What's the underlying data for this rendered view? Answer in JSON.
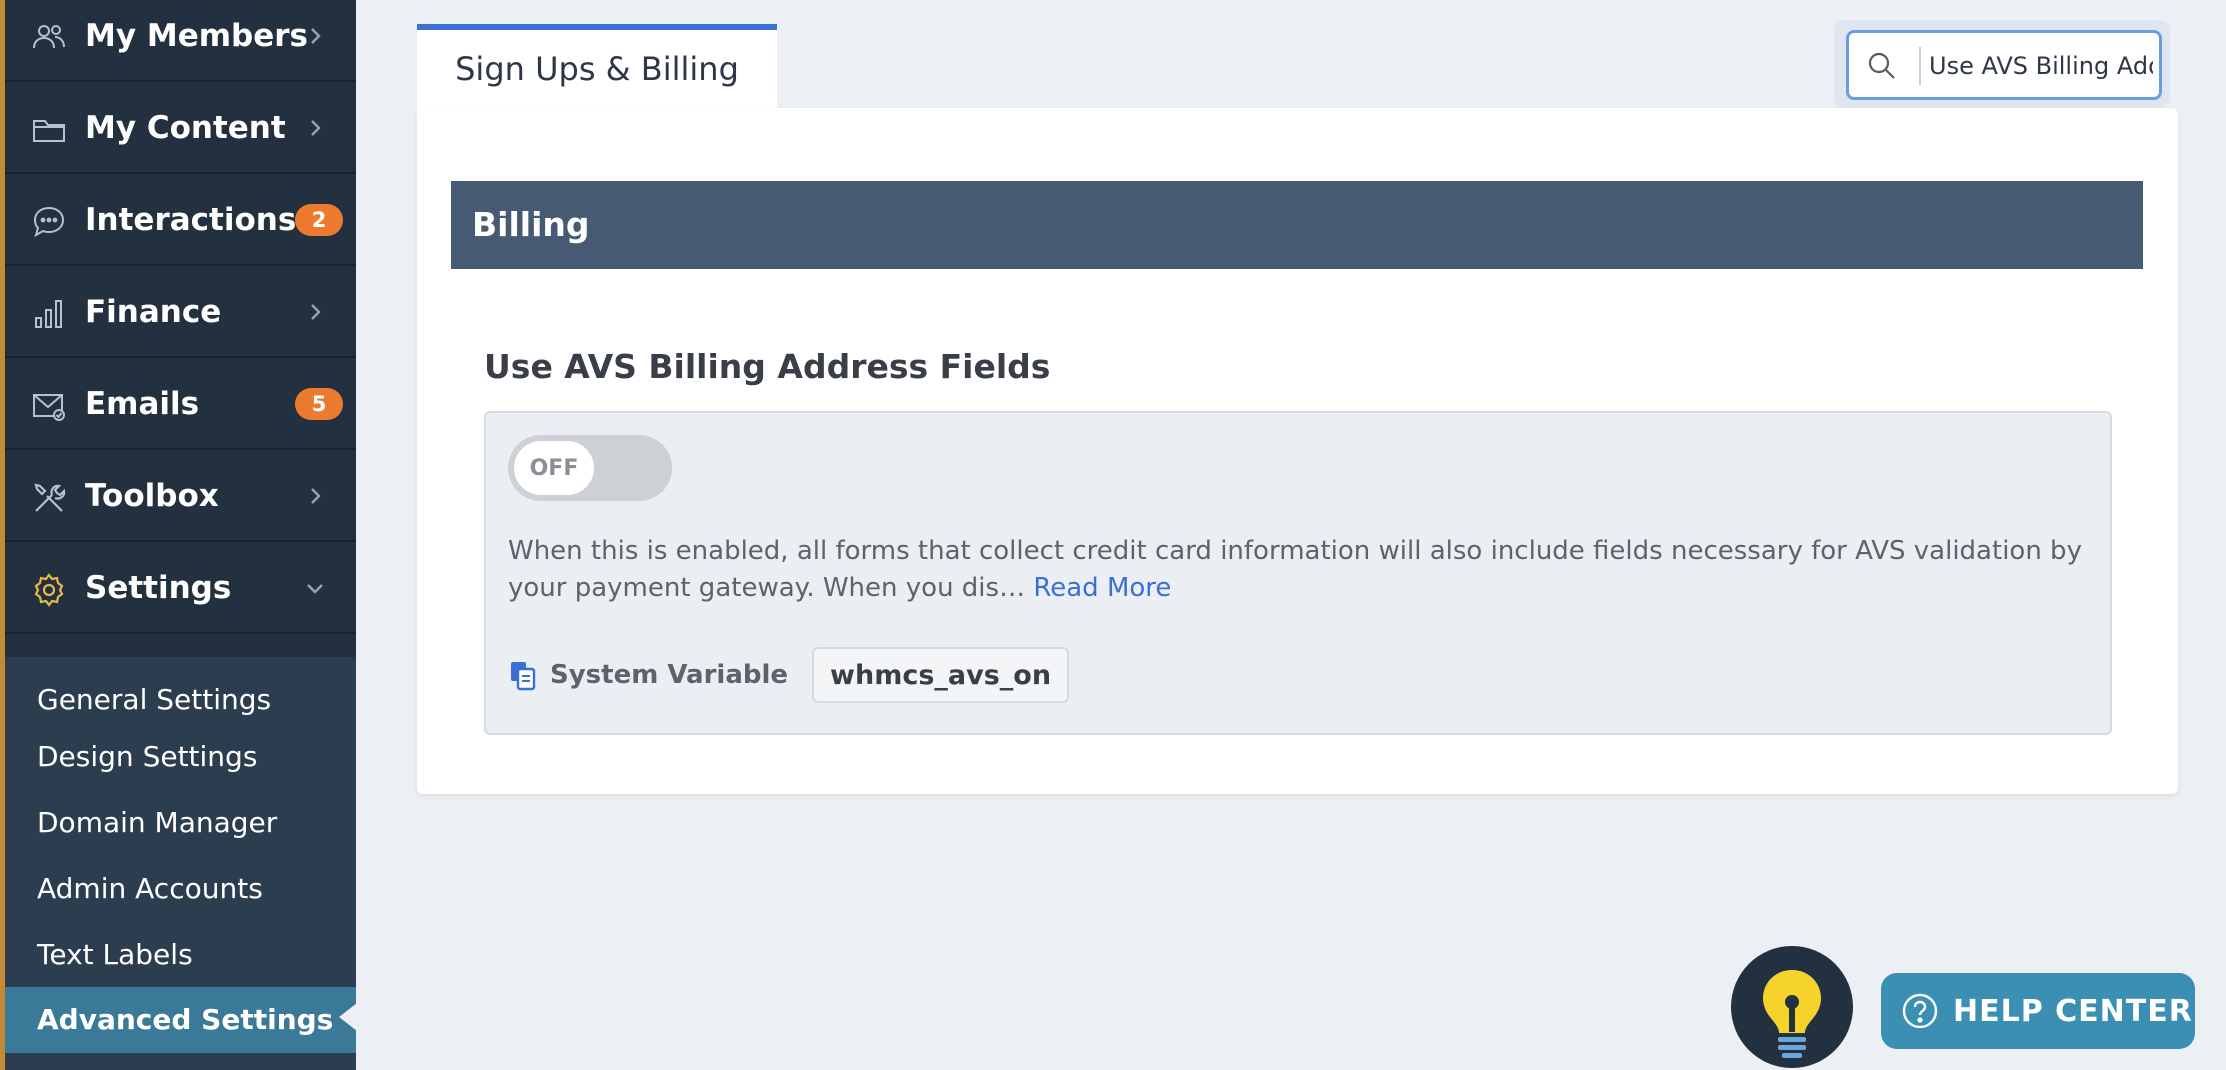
{
  "sidebar": {
    "items": [
      {
        "label": "My Members",
        "icon": "members-icon"
      },
      {
        "label": "My Content",
        "icon": "folder-icon"
      },
      {
        "label": "Interactions",
        "icon": "chat-icon",
        "badge": "2"
      },
      {
        "label": "Finance",
        "icon": "bar-chart-icon"
      },
      {
        "label": "Emails",
        "icon": "envelope-icon",
        "badge": "5"
      },
      {
        "label": "Toolbox",
        "icon": "tools-icon"
      },
      {
        "label": "Settings",
        "icon": "gear-icon"
      }
    ],
    "submenu": [
      {
        "label": "General Settings"
      },
      {
        "label": "Design Settings"
      },
      {
        "label": "Domain Manager"
      },
      {
        "label": "Admin Accounts"
      },
      {
        "label": "Text Labels"
      },
      {
        "label": "Advanced Settings",
        "active": true
      }
    ]
  },
  "tabs": [
    {
      "label": "Sign Ups & Billing",
      "active": true
    }
  ],
  "search": {
    "value": "Use AVS Billing Address Fields"
  },
  "section": {
    "title": "Billing"
  },
  "setting": {
    "title": "Use AVS Billing Address Fields",
    "toggle_label": "OFF",
    "description": "When this is enabled, all forms that collect credit card information will also include fields necessary for AVS validation by your payment gateway. When you dis… ",
    "read_more": "Read More",
    "system_variable_label": "System Variable",
    "system_variable_value": "whmcs_avs_on"
  },
  "help": {
    "label": "HELP CENTER"
  },
  "colors": {
    "sidebar_bg": "#23303f",
    "accent_blue": "#3a70d4",
    "active_teal": "#3a7a98",
    "badge_orange": "#ec7a2f",
    "section_header": "#475a73",
    "bulb_yellow": "#f5d32a"
  }
}
